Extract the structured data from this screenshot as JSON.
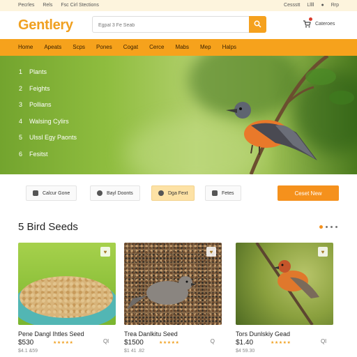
{
  "topbar": {
    "left": [
      "Pecrles",
      "Rels",
      "Fsc Cirl Stections"
    ],
    "right": [
      "Cessstt",
      "Lllll",
      "Rrp"
    ]
  },
  "header": {
    "logo": "Gentlery",
    "search_placeholder": "Egpal 3 Fe Seab",
    "cart_label": "Cateroes"
  },
  "nav": [
    "Home",
    "Apeats",
    "Scps",
    "Pones",
    "Cogat",
    "Cerce",
    "Mabs",
    "Mep",
    "Halps"
  ],
  "hero": {
    "items": [
      {
        "num": "1",
        "label": "Plants"
      },
      {
        "num": "2",
        "label": "Feights"
      },
      {
        "num": "3",
        "label": "Pollians"
      },
      {
        "num": "4",
        "label": "Walsing Cylirs"
      },
      {
        "num": "5",
        "label": "Ulssl Egy Paonts"
      },
      {
        "num": "6",
        "label": "Fesitst"
      }
    ]
  },
  "chips": [
    {
      "label": "Calcur Gone",
      "icon": "box-icon"
    },
    {
      "label": "Bayl Doonts",
      "icon": "bird-icon"
    },
    {
      "label": "Dga Fext",
      "icon": "seed-icon",
      "active": true
    },
    {
      "label": "Fetes",
      "icon": "tag-icon"
    }
  ],
  "cta_label": "Ceset New",
  "section_title": "5 Bird Seeds",
  "products": [
    {
      "name": "Pene Dangl Ihtles Seed",
      "price": "$530",
      "old_price": "$4.1 &59",
      "stars": "★★★★★",
      "more": "Ql"
    },
    {
      "name": "Trea Danlkitu Seed",
      "price": "$1500",
      "old_price": "$1 41 .82",
      "stars": "★★★★★",
      "more": "Q"
    },
    {
      "name": "Tors Dunlskiy Gead",
      "price": "$1.40",
      "old_price": "$4 59.30",
      "stars": "★★★★★",
      "more": "Ql"
    }
  ],
  "colors": {
    "accent": "#f5a11e",
    "cta": "#f5911c",
    "hero": "#8fbd3f"
  }
}
